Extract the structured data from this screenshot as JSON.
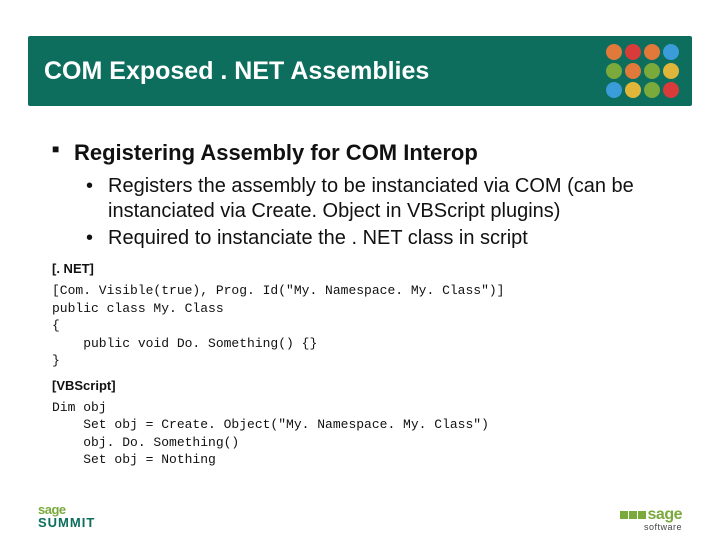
{
  "title": "COM Exposed . NET Assemblies",
  "heading": "Registering Assembly for COM Interop",
  "bullets": [
    "Registers the assembly to be instanciated via COM (can be instanciated via Create. Object in VBScript plugins)",
    "Required to instanciate the . NET class in script"
  ],
  "code_net": {
    "label": "[. NET]",
    "lines": [
      "[Com. Visible(true), Prog. Id(\"My. Namespace. My. Class\")]",
      "public class My. Class",
      "{",
      "    public void Do. Something() {}",
      "}"
    ]
  },
  "code_vbs": {
    "label": "[VBScript]",
    "lines": [
      "Dim obj",
      "    Set obj = Create. Object(\"My. Namespace. My. Class\")",
      "    obj. Do. Something()",
      "    Set obj = Nothing"
    ]
  },
  "logo_colors": [
    "#e0793a",
    "#d93a3a",
    "#e0793a",
    "#3a9cd9",
    "#7aa93c",
    "#e0793a",
    "#7aa93c",
    "#e0b63a",
    "#3a9cd9",
    "#e0b63a",
    "#7aa93c",
    "#d93a3a"
  ],
  "footer": {
    "left_top": "sage",
    "left_bottom": "SUMMIT",
    "right_brand": "sage",
    "right_sub": "software"
  }
}
